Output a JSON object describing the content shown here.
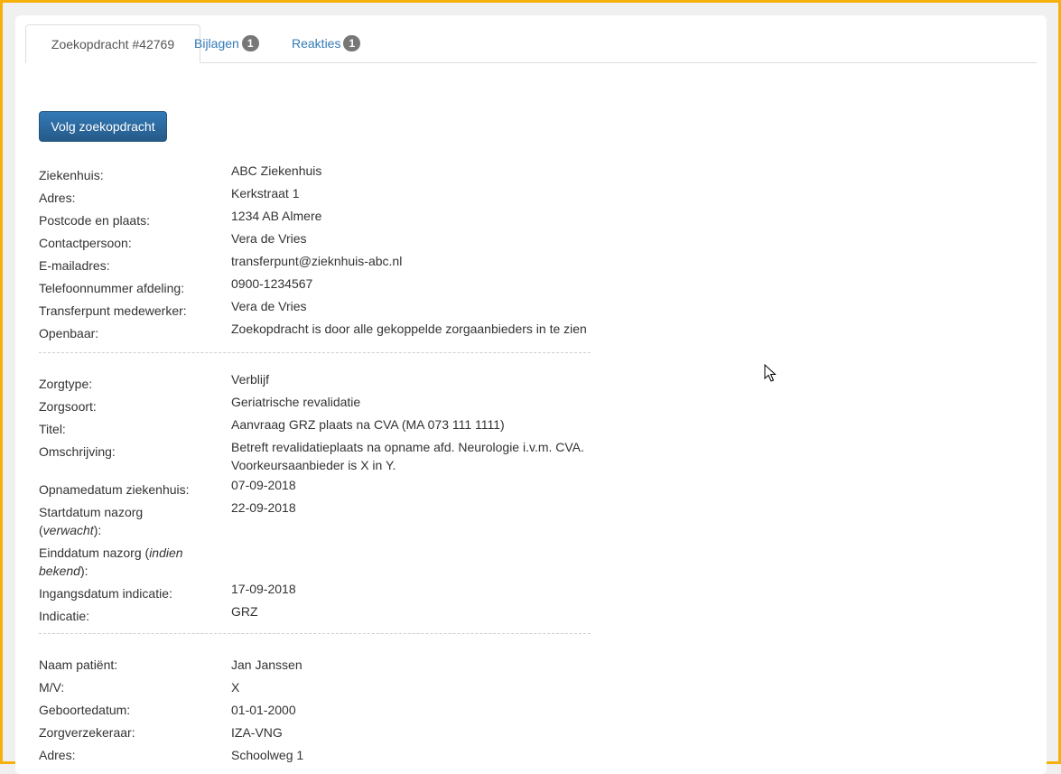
{
  "tabs": [
    {
      "label": "Zoekopdracht #42769"
    },
    {
      "label": "Bijlagen",
      "badge": "1"
    },
    {
      "label": "Reakties",
      "badge": "1"
    }
  ],
  "follow_button": "Volg zoekopdracht",
  "section1": [
    {
      "label": "Ziekenhuis:",
      "value": "ABC Ziekenhuis"
    },
    {
      "label": "Adres:",
      "value": "Kerkstraat 1"
    },
    {
      "label": "Postcode en plaats:",
      "value": "1234 AB Almere"
    },
    {
      "label": "Contactpersoon:",
      "value": "Vera de Vries"
    },
    {
      "label": "E-mailadres:",
      "value": "transferpunt@zieknhuis-abc.nl"
    },
    {
      "label": "Telefoonnummer afdeling:",
      "value": "0900-1234567"
    },
    {
      "label": "Transferpunt medewerker:",
      "value": "Vera de Vries"
    },
    {
      "label": "Openbaar:",
      "value": "Zoekopdracht is door alle gekoppelde zorgaanbieders in te zien"
    }
  ],
  "section2": [
    {
      "label": "Zorgtype:",
      "value": "Verblijf"
    },
    {
      "label": "Zorgsoort:",
      "value": "Geriatrische revalidatie"
    },
    {
      "label": "Titel:",
      "value": "Aanvraag GRZ plaats na CVA (MA 073 111 1111)"
    },
    {
      "label": "Omschrijving:",
      "value": "Betreft revalidatieplaats na opname afd. Neurologie i.v.m. CVA.",
      "value2": "Voorkeursaanbieder is X in Y."
    },
    {
      "label": "Opnamedatum ziekenhuis:",
      "value": "07-09-2018"
    },
    {
      "label_a": "Startdatum nazorg",
      "label_b": "(",
      "label_em": "verwacht",
      "label_c": "):",
      "value": "22-09-2018"
    },
    {
      "label_a": "Einddatum nazorg (",
      "label_em1": "indien",
      "label_em2": "bekend",
      "label_c": "):",
      "value": ""
    },
    {
      "label": "Ingangsdatum indicatie:",
      "value": "17-09-2018"
    },
    {
      "label": "Indicatie:",
      "value": "GRZ"
    }
  ],
  "section3": [
    {
      "label": "Naam patiënt:",
      "value": "Jan Janssen"
    },
    {
      "label": "M/V:",
      "value": "X"
    },
    {
      "label": "Geboortedatum:",
      "value": "01-01-2000"
    },
    {
      "label": "Zorgverzekeraar:",
      "value": "IZA-VNG"
    },
    {
      "label": "Adres:",
      "value": "Schoolweg 1"
    }
  ]
}
